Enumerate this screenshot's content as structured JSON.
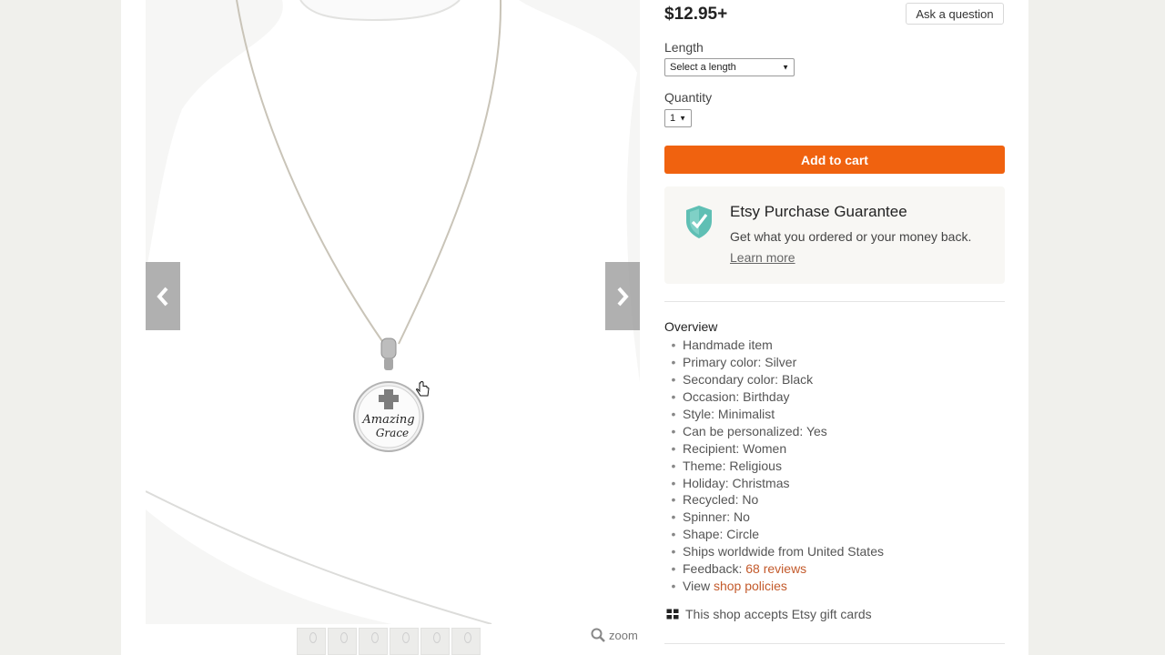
{
  "product": {
    "price": "$12.95+",
    "ask_label": "Ask a question",
    "length_label": "Length",
    "length_value": "Select a length",
    "quantity_label": "Quantity",
    "quantity_value": "1",
    "add_to_cart_label": "Add to cart",
    "pendant_text_1": "Amazing",
    "pendant_text_2": "Grace"
  },
  "guarantee": {
    "title": "Etsy Purchase Guarantee",
    "text": "Get what you ordered or your money back.",
    "link": "Learn more"
  },
  "overview": {
    "title": "Overview",
    "items": [
      "Handmade item",
      "Primary color: Silver",
      "Secondary color: Black",
      "Occasion: Birthday",
      "Style: Minimalist",
      "Can be personalized: Yes",
      "Recipient: Women",
      "Theme: Religious",
      "Holiday: Christmas",
      "Recycled: No",
      "Spinner: No",
      "Shape: Circle",
      "Ships worldwide from United States"
    ],
    "feedback_prefix": "Feedback: ",
    "feedback_link": "68 reviews",
    "policies_prefix": "View ",
    "policies_link": "shop policies"
  },
  "giftcard_text": "This shop accepts Etsy gift cards",
  "gallery": {
    "zoom_label": "zoom",
    "thumbnail_count": 6
  },
  "colors": {
    "accent": "#f0620f",
    "link": "#c35a2b",
    "guarantee_bg": "#f8f7f4",
    "shield": "#5fbfb4"
  },
  "icons": [
    "chevron-left-icon",
    "chevron-right-icon",
    "magnifier-icon",
    "shield-check-icon",
    "gift-card-icon",
    "hand-cursor-icon"
  ]
}
